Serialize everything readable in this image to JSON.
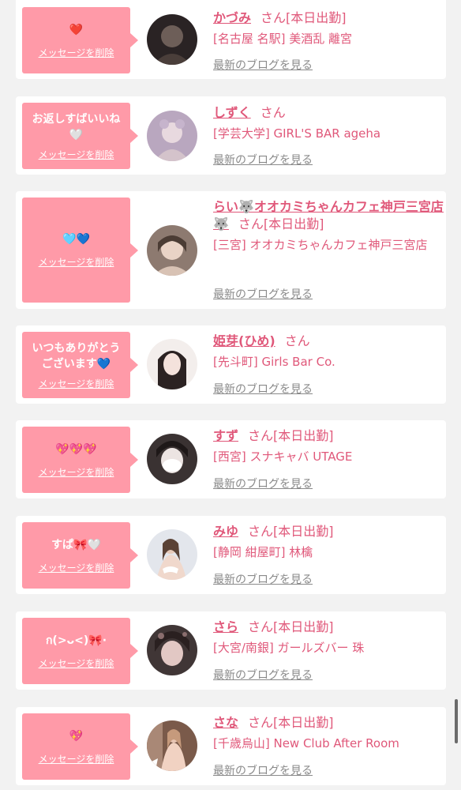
{
  "cards": [
    {
      "message": "❤️",
      "delete_label": "メッセージを削除",
      "name": "かづみ",
      "suffix": "さん[本日出勤]",
      "shop": "[名古屋 名駅] 美酒乱 離宮",
      "blog_label": "最新のブログを見る",
      "avatar_color": "#2a2324"
    },
    {
      "message": "お返しすばいいね🤍",
      "delete_label": "メッセージを削除",
      "name": "しずく",
      "suffix": "さん",
      "shop": "[学芸大学] GIRL'S BAR ageha",
      "blog_label": "最新のブログを見る",
      "avatar_color": "#b9a7bf"
    },
    {
      "message": "🩵💙",
      "delete_label": "メッセージを削除",
      "name": "らい🐺オオカミちゃんカフェ神戸三宮店🐺",
      "suffix": "さん[本日出勤]",
      "shop": "[三宮] オオカミちゃんカフェ神戸三宮店",
      "blog_label": "最新のブログを見る",
      "avatar_color": "#8d7a70"
    },
    {
      "message": "いつもありがとうございます💙",
      "delete_label": "メッセージを削除",
      "name": "姫芽(ひめ)",
      "suffix": "さん",
      "shop": "[先斗町] Girls Bar Co.",
      "blog_label": "最新のブログを見る",
      "avatar_color": "#d8cfca"
    },
    {
      "message": "💖💖💖",
      "delete_label": "メッセージを削除",
      "name": "すず",
      "suffix": "さん[本日出勤]",
      "shop": "[西宮] スナキャバ UTAGE",
      "blog_label": "最新のブログを見る",
      "avatar_color": "#3a3232"
    },
    {
      "message": "すぱ🎀🤍",
      "delete_label": "メッセージを削除",
      "name": "みゆ",
      "suffix": "さん[本日出勤]",
      "shop": "[静岡 紺屋町] 林檎",
      "blog_label": "最新のブログを見る",
      "avatar_color": "#e3e6ec"
    },
    {
      "message": "ก(>ᴗ<)🎀·",
      "delete_label": "メッセージを削除",
      "name": "さら",
      "suffix": "さん[本日出勤]",
      "shop": "[大宮/南銀] ガールズバー 珠",
      "blog_label": "最新のブログを見る",
      "avatar_color": "#403636"
    },
    {
      "message": "💖",
      "delete_label": "メッセージを削除",
      "name": "さな",
      "suffix": "さん[本日出勤]",
      "shop": "[千歳烏山] New Club After Room",
      "blog_label": "最新のブログを見る",
      "avatar_color": "#7a5a4a"
    }
  ]
}
